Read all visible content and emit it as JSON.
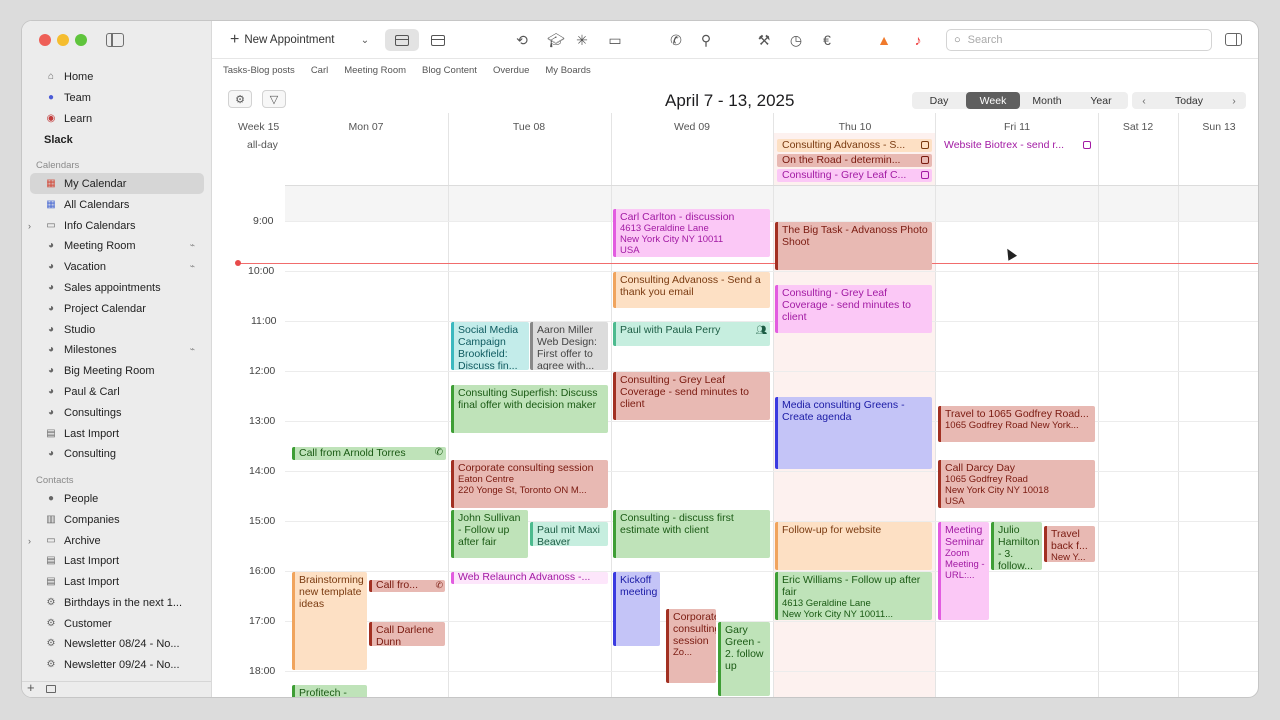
{
  "toolbar": {
    "new_appointment": "New Appointment",
    "search_placeholder": "Search"
  },
  "favorites": [
    "Tasks-Blog posts",
    "Carl",
    "Meeting Room",
    "Blog Content",
    "Overdue",
    "My Boards"
  ],
  "header": {
    "title": "April 7 - 13, 2025",
    "views": [
      "Day",
      "Week",
      "Month",
      "Year"
    ],
    "active_view": "Week",
    "today": "Today"
  },
  "sidebar": {
    "top": [
      {
        "label": "Home",
        "icon": "house-icon"
      },
      {
        "label": "Team",
        "icon": "team-icon"
      },
      {
        "label": "Learn",
        "icon": "learn-icon"
      },
      {
        "label": "Slack",
        "icon": ""
      }
    ],
    "calendars_heading": "Calendars",
    "calendars": [
      {
        "label": "My Calendar",
        "icon": "calendar-icon",
        "selected": true
      },
      {
        "label": "All Calendars",
        "icon": "calendar-icon"
      },
      {
        "label": "Info Calendars",
        "icon": "folder-icon",
        "disclosure": true
      },
      {
        "label": "Meeting Room",
        "icon": "group-calendar-icon",
        "shared": true
      },
      {
        "label": "Vacation",
        "icon": "group-calendar-icon",
        "shared": true
      },
      {
        "label": "Sales appointments",
        "icon": "group-calendar-icon"
      },
      {
        "label": "Project Calendar",
        "icon": "group-calendar-icon"
      },
      {
        "label": "Studio",
        "icon": "group-calendar-icon"
      },
      {
        "label": "Milestones",
        "icon": "group-calendar-icon",
        "shared": true
      },
      {
        "label": "Big Meeting Room",
        "icon": "group-calendar-icon"
      },
      {
        "label": "Paul & Carl",
        "icon": "group-calendar-icon"
      },
      {
        "label": "Consultings",
        "icon": "group-calendar-icon"
      },
      {
        "label": "Last Import",
        "icon": "import-icon"
      },
      {
        "label": "Consulting",
        "icon": "group-calendar-icon"
      }
    ],
    "contacts_heading": "Contacts",
    "contacts": [
      {
        "label": "People",
        "icon": "person-icon"
      },
      {
        "label": "Companies",
        "icon": "building-icon"
      },
      {
        "label": "Archive",
        "icon": "folder-icon",
        "disclosure": true
      },
      {
        "label": "Last Import",
        "icon": "import-icon"
      },
      {
        "label": "Last Import",
        "icon": "import-icon"
      },
      {
        "label": "Birthdays in the next 1...",
        "icon": "smart-group-icon"
      },
      {
        "label": "Customer",
        "icon": "smart-group-icon"
      },
      {
        "label": "Newsletter 08/24 - No...",
        "icon": "smart-group-icon"
      },
      {
        "label": "Newsletter 09/24 - No...",
        "icon": "smart-group-icon"
      }
    ]
  },
  "week": {
    "label": "Week 15",
    "all_day": "all-day",
    "days": [
      "Mon 07",
      "Tue 08",
      "Wed 09",
      "Thu 10",
      "Fri 11",
      "Sat 12",
      "Sun 13"
    ],
    "hours": [
      "9:00",
      "10:00",
      "11:00",
      "12:00",
      "13:00",
      "14:00",
      "15:00",
      "16:00",
      "17:00",
      "18:00"
    ]
  },
  "allday_events": [
    {
      "title": "Consulting Advanoss - S...",
      "color": "orange",
      "day": "Thu 10"
    },
    {
      "title": "On the Road - determin...",
      "color": "red",
      "day": "Thu 10"
    },
    {
      "title": "Consulting - Grey Leaf C...",
      "color": "pink",
      "day": "Thu 10"
    },
    {
      "title": "Website Biotrex - send r...",
      "color": "pink",
      "day": "Fri 11"
    }
  ],
  "events": [
    {
      "id": "wed-carl",
      "title": "Carl Carlton - discussion",
      "sub": "4613 Geraldine Lane\nNew York City  NY 10011\nUSA",
      "color": "pink",
      "day": "Wed 09"
    },
    {
      "id": "thu-bigtask",
      "title": "The Big Task - Advanoss Photo Shoot",
      "sub": "",
      "color": "red",
      "day": "Thu 10"
    },
    {
      "id": "wed-thanks",
      "title": "Consulting Advanoss - Send a thank you email",
      "sub": "",
      "color": "orange",
      "day": "Wed 09"
    },
    {
      "id": "thu-greyleaf",
      "title": "Consulting - Grey Leaf Coverage - send minutes to client",
      "sub": "",
      "color": "pink",
      "day": "Thu 10"
    },
    {
      "id": "tue-social",
      "title": "Social Media Campaign Brookfield: Discuss fin...",
      "sub": "",
      "color": "teal",
      "day": "Tue 08"
    },
    {
      "id": "tue-aaron",
      "title": "Aaron Miller Web Design: First offer to agree with...",
      "sub": "",
      "color": "grey",
      "day": "Tue 08"
    },
    {
      "id": "wed-paula",
      "title": "Paul with Paula Perry",
      "sub": "",
      "color": "mint",
      "day": "Wed 09"
    },
    {
      "id": "tue-superfish",
      "title": "Consulting Superfish: Discuss final offer with decision maker",
      "sub": "",
      "color": "green",
      "day": "Tue 08"
    },
    {
      "id": "wed-greyleaf",
      "title": "Consulting - Grey Leaf Coverage - send minutes to client",
      "sub": "",
      "color": "red",
      "day": "Wed 09"
    },
    {
      "id": "thu-media",
      "title": "Media consulting Greens - Create agenda",
      "sub": "",
      "color": "blue",
      "day": "Thu 10"
    },
    {
      "id": "fri-travel",
      "title": "Travel to 1065 Godfrey Road...",
      "sub": "1065 Godfrey Road New York...",
      "color": "red",
      "day": "Fri 11"
    },
    {
      "id": "mon-arnold",
      "title": "Call from Arnold Torres",
      "sub": "",
      "color": "green",
      "day": "Mon 07"
    },
    {
      "id": "tue-corporate",
      "title": "Corporate consulting session",
      "sub": "Eaton Centre\n220 Yonge St, Toronto ON M...",
      "color": "red",
      "day": "Tue 08"
    },
    {
      "id": "fri-darcy",
      "title": "Call Darcy Day",
      "sub": "1065 Godfrey Road\nNew York City  NY 10018\nUSA",
      "color": "red",
      "day": "Fri 11"
    },
    {
      "id": "tue-john",
      "title": "John Sullivan - Follow up after fair",
      "sub": "",
      "color": "green",
      "day": "Tue 08"
    },
    {
      "id": "tue-paul",
      "title": "Paul mit Maxi Beaver",
      "sub": "",
      "color": "mint",
      "day": "Tue 08"
    },
    {
      "id": "wed-estimate",
      "title": "Consulting - discuss first estimate with client",
      "sub": "",
      "color": "green",
      "day": "Wed 09"
    },
    {
      "id": "thu-followup",
      "title": "Follow-up for website",
      "sub": "",
      "color": "orange",
      "day": "Thu 10"
    },
    {
      "id": "fri-meeting",
      "title": "Meeting Seminar",
      "sub": "Zoom Meeting -URL:...",
      "color": "pink",
      "day": "Fri 11"
    },
    {
      "id": "fri-julio",
      "title": "Julio Hamilton - 3. follow...",
      "sub": "",
      "color": "green",
      "day": "Fri 11"
    },
    {
      "id": "fri-travelback",
      "title": "Travel back f...",
      "sub": "New Y...",
      "color": "red",
      "day": "Fri 11"
    },
    {
      "id": "tue-relaunch",
      "title": "Web Relaunch Advanoss -...",
      "sub": "",
      "color": "pink",
      "day": "Tue 08"
    },
    {
      "id": "mon-brainstorm",
      "title": "Brainstorming new template ideas",
      "sub": "",
      "color": "orange",
      "day": "Mon 07"
    },
    {
      "id": "mon-callfro",
      "title": "Call fro...",
      "sub": "",
      "color": "red",
      "day": "Mon 07"
    },
    {
      "id": "wed-kickoff",
      "title": "Kickoff meeting",
      "sub": "",
      "color": "blue",
      "day": "Wed 09"
    },
    {
      "id": "thu-eric",
      "title": "Eric Williams - Follow up after fair",
      "sub": "4613 Geraldine Lane\nNew York City  NY 10011...",
      "color": "green",
      "day": "Thu 10"
    },
    {
      "id": "mon-darlene",
      "title": "Call Darlene Dunn",
      "sub": "",
      "color": "red",
      "day": "Mon 07"
    },
    {
      "id": "wed-corporate",
      "title": "Corporate consulting session",
      "sub": "Zo...",
      "color": "red",
      "day": "Wed 09"
    },
    {
      "id": "wed-gary",
      "title": "Gary Green - 2. follow up",
      "sub": "",
      "color": "green",
      "day": "Wed 09"
    },
    {
      "id": "mon-profitech",
      "title": "Profitech -",
      "sub": "",
      "color": "green",
      "day": "Mon 07"
    }
  ]
}
